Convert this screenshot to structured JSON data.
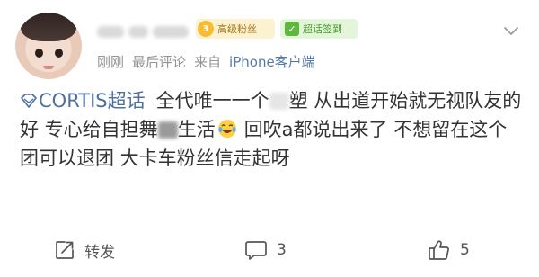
{
  "badges": {
    "fan_level": "3",
    "fan_label": "高级粉丝",
    "sign_label": "超话签到"
  },
  "meta": {
    "time": "刚刚",
    "type": "最后评论",
    "source_prefix": "来自",
    "device": "iPhone客户端"
  },
  "content": {
    "topic": "CORTIS超话",
    "t1": "全代唯一一个",
    "t2": "塑 从出道开始就无视队友的好 专心给自担舞",
    "t3": "生活",
    "t4": "回吹a都说出来了 不想留在这个团可以退团 大卡车粉丝信走起呀"
  },
  "actions": {
    "repost_label": "转发",
    "comment_count": "3",
    "like_count": "5"
  },
  "icons": {
    "topic": "diamond-topic-icon",
    "chevron": "chevron-down-icon",
    "repost": "repost-icon",
    "comment": "comment-icon",
    "like": "thumbs-up-icon",
    "emoji": "laugh-cry-emoji-icon",
    "check": "check-icon"
  },
  "colors": {
    "link": "#4f6fa3",
    "meta": "#939393",
    "fan_badge_bg": "#fdf2cf",
    "sign_badge_bg": "#e4f6d9"
  }
}
